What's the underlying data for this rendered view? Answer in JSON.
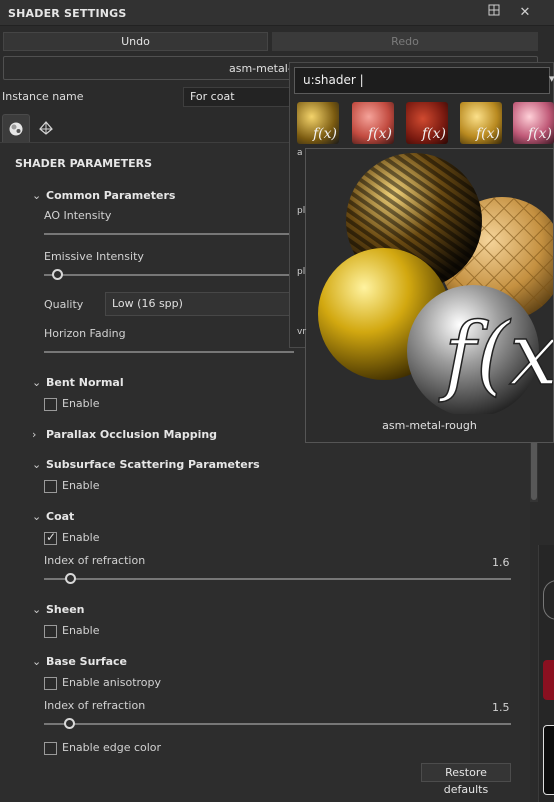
{
  "window": {
    "title": "SHADER SETTINGS"
  },
  "toolbar": {
    "undo_label": "Undo",
    "redo_label": "Redo"
  },
  "shader_selector": {
    "value": "asm-metal-ro"
  },
  "instance": {
    "label": "Instance name",
    "value": "For coat"
  },
  "section": {
    "title": "SHADER PARAMETERS"
  },
  "common": {
    "title": "Common Parameters",
    "ao_label": "AO Intensity",
    "emissive_label": "Emissive Intensity",
    "quality_label": "Quality",
    "quality_value": "Low (16 spp)",
    "horizon_label": "Horizon Fading"
  },
  "bent_normal": {
    "title": "Bent Normal",
    "enable_label": "Enable",
    "enabled": false
  },
  "parallax": {
    "title": "Parallax Occlusion Mapping"
  },
  "subsurface": {
    "title": "Subsurface Scattering Parameters",
    "enable_label": "Enable",
    "enabled": false
  },
  "coat": {
    "title": "Coat",
    "enable_label": "Enable",
    "enabled": true,
    "ior_label": "Index of refraction",
    "ior_value": "1.6"
  },
  "sheen": {
    "title": "Sheen",
    "enable_label": "Enable",
    "enabled": false
  },
  "base_surface": {
    "title": "Base Surface",
    "anisotropy_label": "Enable anisotropy",
    "ior_label": "Index of refraction",
    "ior_value": "1.5",
    "edge_color_label": "Enable edge color"
  },
  "restore_label": "Restore defaults",
  "popup": {
    "search_value": "u:shader |",
    "preview_caption": "asm-metal-rough",
    "preview_fx": "f(x)",
    "thumb_fx": "f(x)"
  },
  "colors": {
    "background": "#2b2b2b",
    "panel": "#2d2d2d",
    "accent": "#d8d8d8"
  }
}
